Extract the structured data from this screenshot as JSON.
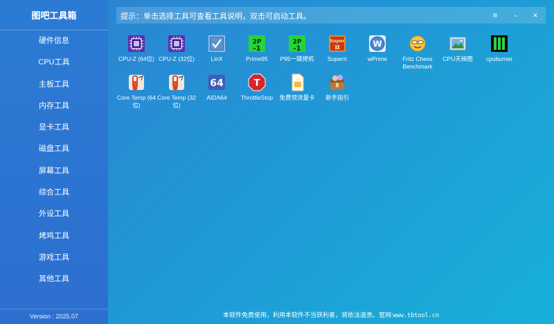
{
  "app": {
    "title": "图吧工具箱",
    "version": "Version : 2025.07"
  },
  "sidebar": {
    "items": [
      {
        "label": "硬件信息"
      },
      {
        "label": "CPU工具"
      },
      {
        "label": "主板工具"
      },
      {
        "label": "内存工具"
      },
      {
        "label": "显卡工具"
      },
      {
        "label": "磁盘工具"
      },
      {
        "label": "屏幕工具"
      },
      {
        "label": "综合工具"
      },
      {
        "label": "外设工具"
      },
      {
        "label": "烤鸡工具"
      },
      {
        "label": "游戏工具"
      },
      {
        "label": "其他工具"
      }
    ]
  },
  "tipbar": {
    "text": "提示：单击选择工具可查看工具说明，双击可启动工具。",
    "menu_icon": "≡",
    "minimize_icon": "-",
    "close_icon": "×"
  },
  "tools": [
    {
      "label": "CPU-Z (64位)",
      "icon": "cpuz-icon"
    },
    {
      "label": "CPU-Z (32位)",
      "icon": "cpuz-icon"
    },
    {
      "label": "LinX",
      "icon": "linx-icon"
    },
    {
      "label": "Prime95",
      "icon": "prime95-icon"
    },
    {
      "label": "P95一键烤机",
      "icon": "prime95-icon"
    },
    {
      "label": "Superπ",
      "icon": "superpi-icon"
    },
    {
      "label": "wPrime",
      "icon": "wprime-icon"
    },
    {
      "label": "Fritz Chess Benchmark",
      "icon": "fritz-icon"
    },
    {
      "label": "CPU天梯图",
      "icon": "cpu-ladder-icon"
    },
    {
      "label": "cpuburner",
      "icon": "cpuburner-icon"
    },
    {
      "label": "Core Temp (64位)",
      "icon": "coretemp-icon"
    },
    {
      "label": "Core Temp (32位)",
      "icon": "coretemp-icon"
    },
    {
      "label": "AIDA64",
      "icon": "aida64-icon"
    },
    {
      "label": "ThrottleStop",
      "icon": "throttlestop-icon"
    },
    {
      "label": "免费领流量卡",
      "icon": "sim-card-icon"
    },
    {
      "label": "新手指引",
      "icon": "guide-icon"
    }
  ],
  "footer": {
    "text": "本软件免费使用，利用本软件不当获利者，将依法追责。官网:",
    "url": "www.tbtool.cn"
  }
}
